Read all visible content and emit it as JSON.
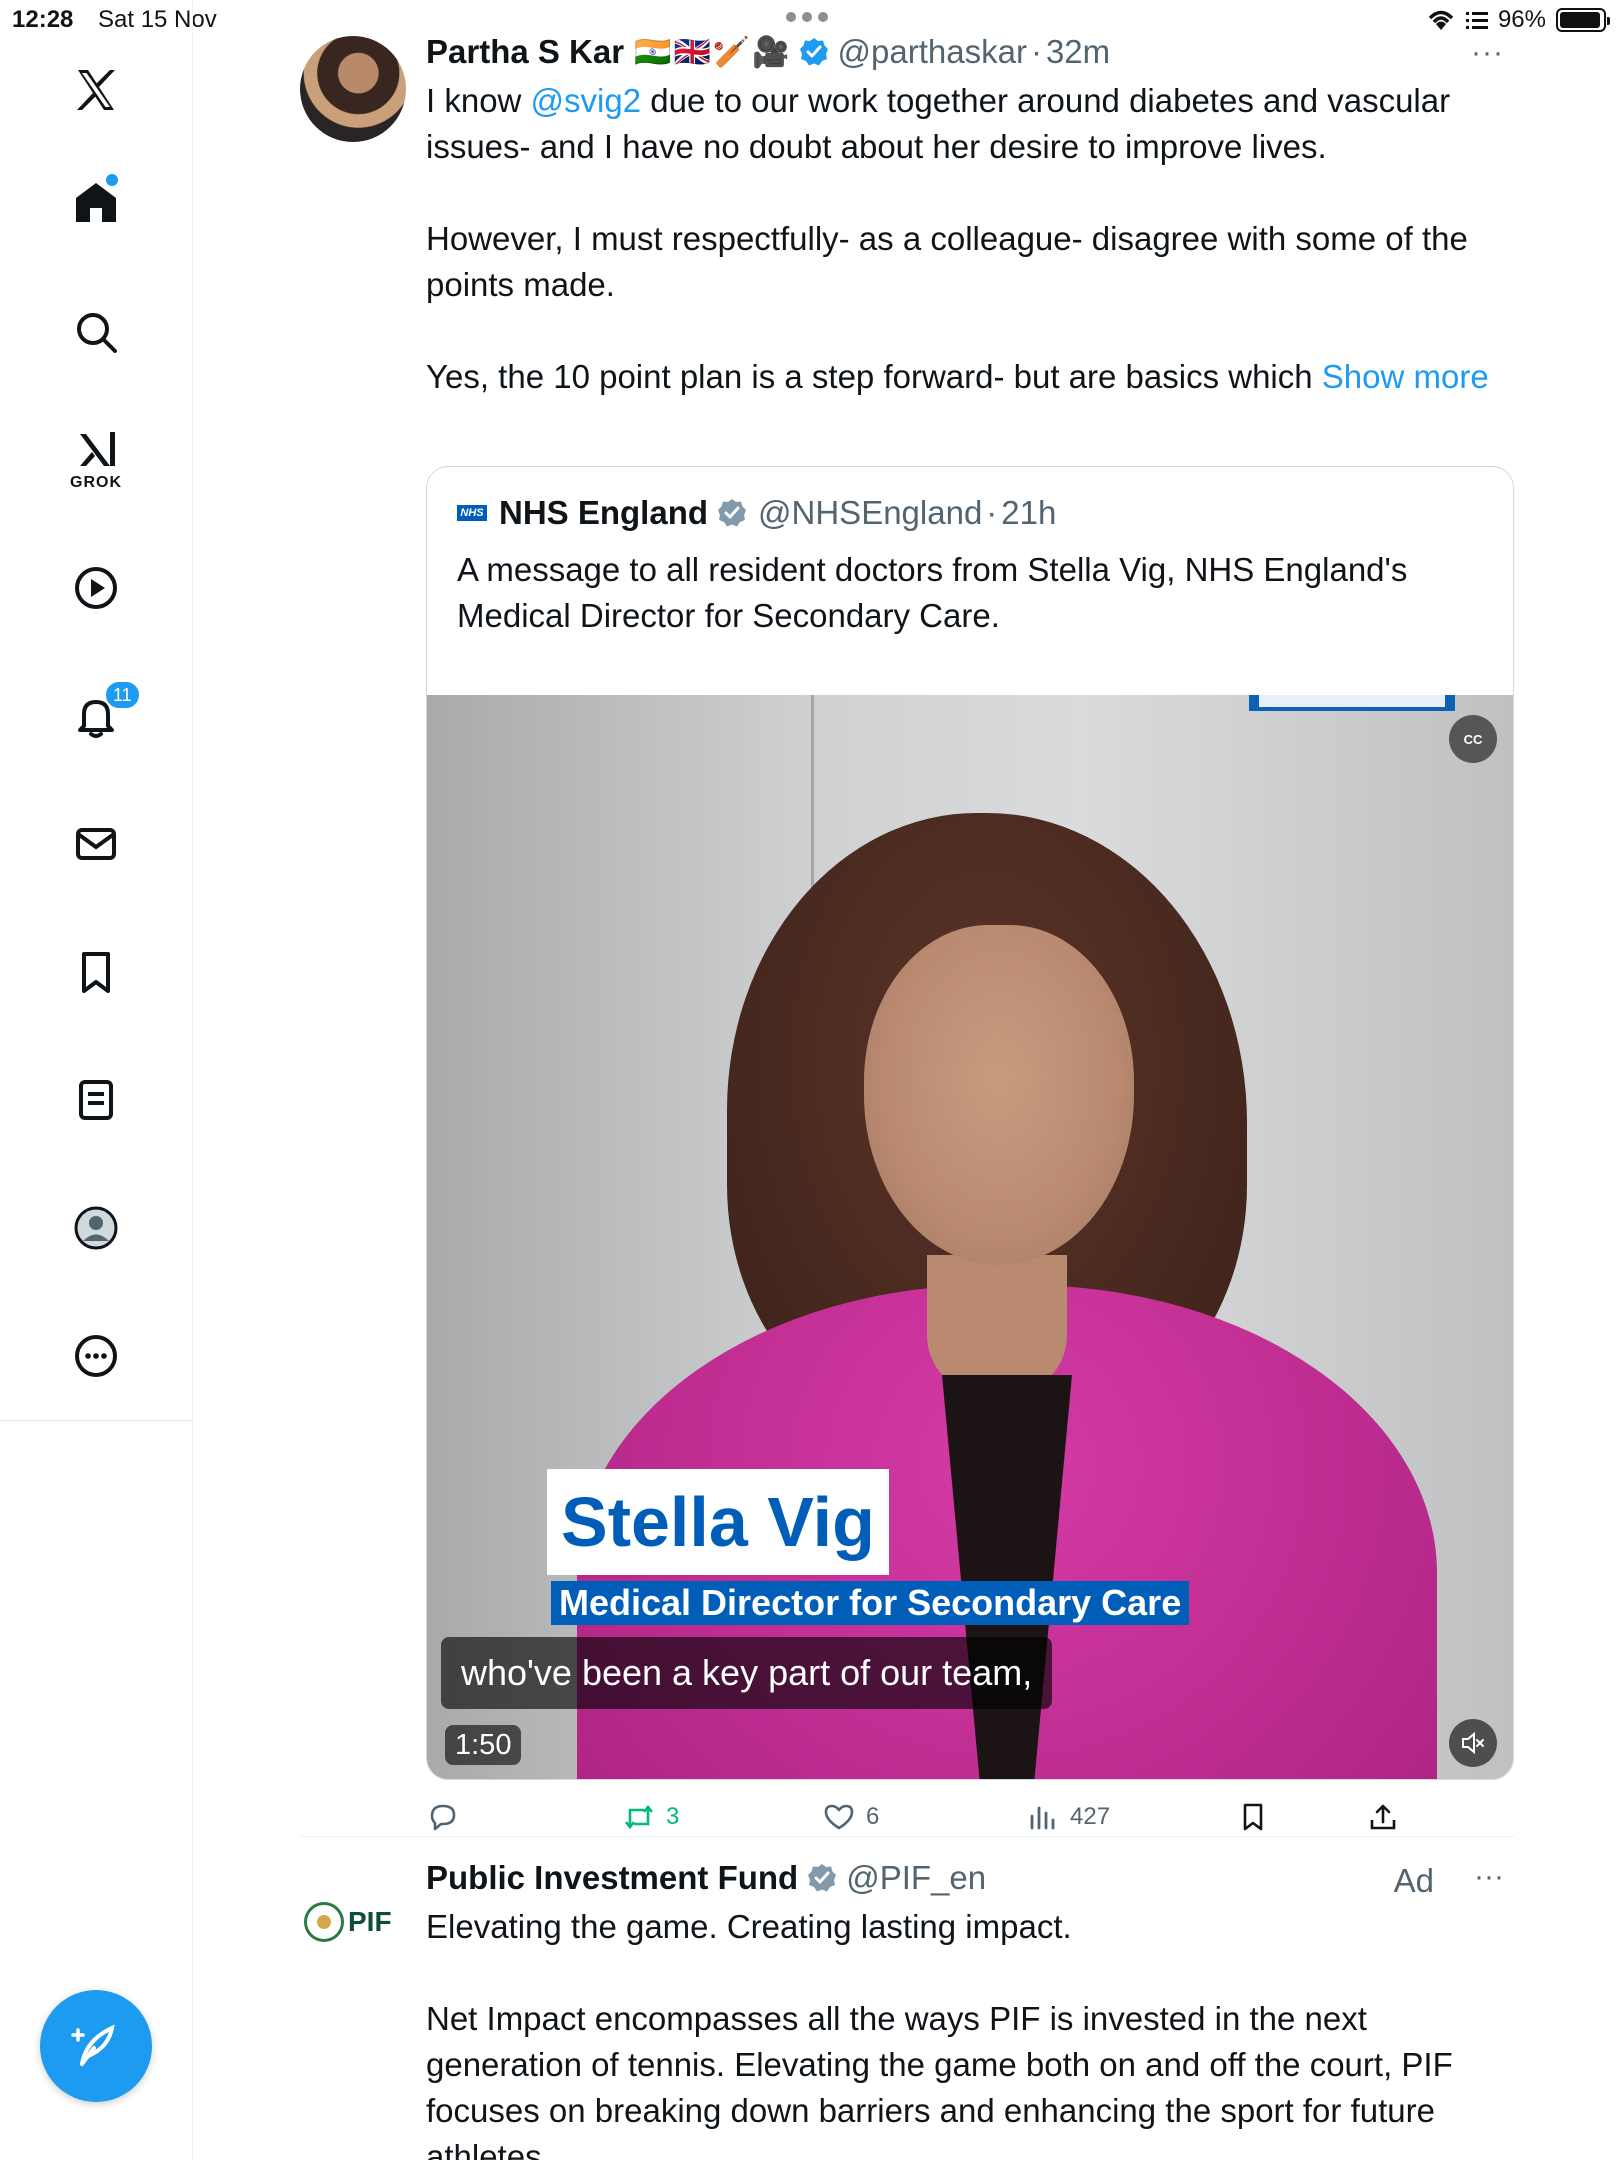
{
  "status_bar": {
    "time": "12:28",
    "date": "Sat 15 Nov",
    "battery": "96%",
    "battery_level": 0.96
  },
  "sidebar": {
    "items": [
      {
        "name": "x-logo-icon"
      },
      {
        "name": "home-icon",
        "unread_dot": true
      },
      {
        "name": "search-icon"
      },
      {
        "name": "grok-icon",
        "label": "GROK"
      },
      {
        "name": "video-icon"
      },
      {
        "name": "notifications-icon",
        "badge": "11"
      },
      {
        "name": "messages-icon"
      },
      {
        "name": "bookmarks-icon"
      },
      {
        "name": "lists-icon"
      },
      {
        "name": "profile-icon"
      },
      {
        "name": "more-icon"
      }
    ],
    "accent": "#1d9bf0"
  },
  "tweet": {
    "author": "Partha S Kar",
    "emojis": "🇮🇳🇬🇧🏏🎥",
    "handle": "@parthaskar",
    "dot": "·",
    "time": "32m",
    "more": "···",
    "text": {
      "p1_a": "I know ",
      "p1_mention": "@svig2",
      "p1_b": " due to our work together around diabetes and vascular issues- and I have no doubt about her desire to improve lives.",
      "p2": "However, I must respectfully- as a colleague- disagree with some of the points made.",
      "p3_a": "Yes, the 10 point plan is a step forward- but are basics which ",
      "show_more": "Show more"
    },
    "quote": {
      "logo_text": "NHS",
      "author": "NHS England",
      "handle": "@NHSEngland",
      "dot": "·",
      "time": "21h",
      "text": "A message to all resident doctors from Stella Vig, NHS England's Medical Director for Secondary Care.",
      "video": {
        "lower_third_name": "Stella Vig",
        "lower_third_role": "Medical Director for Secondary Care",
        "caption": "who've been a key part of our team,",
        "duration": "1:50",
        "cc_label": "CC"
      }
    },
    "actions": {
      "replies": "",
      "reposts": "3",
      "likes": "6",
      "views": "427"
    }
  },
  "ad_tweet": {
    "logo_text": "PIF",
    "author": "Public Investment Fund",
    "handle": "@PIF_en",
    "ad_label": "Ad",
    "more": "···",
    "text_p1": "Elevating the game. Creating lasting impact.",
    "text_p2": "Net Impact encompasses all the ways PIF is invested in the next generation of tennis. Elevating the game both on and off the court, PIF focuses on breaking down barriers and enhancing the sport for future athletes."
  }
}
